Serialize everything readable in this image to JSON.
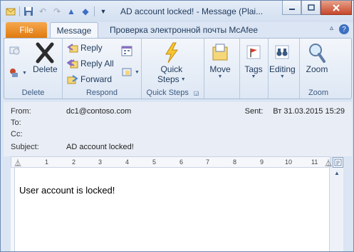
{
  "window": {
    "title": "AD account locked!  -  Message (Plai..."
  },
  "quick_access": [
    "mail-icon",
    "save-icon",
    "undo-icon",
    "redo-icon",
    "up-icon",
    "down-icon",
    "customize-icon"
  ],
  "tabs": {
    "file": "File",
    "message": "Message",
    "mcafee": "Проверка электронной почты McAfee"
  },
  "ribbon": {
    "delete_group": {
      "label": "Delete",
      "delete": "Delete"
    },
    "respond_group": {
      "label": "Respond",
      "reply": "Reply",
      "reply_all": "Reply All",
      "forward": "Forward"
    },
    "quick_steps_group": {
      "label": "Quick Steps",
      "button_line1": "Quick",
      "button_line2": "Steps"
    },
    "move": "Move",
    "tags": "Tags",
    "editing": "Editing",
    "zoom_group": {
      "label": "Zoom",
      "zoom": "Zoom"
    }
  },
  "header": {
    "from_label": "From:",
    "from_value": "dc1@contoso.com",
    "to_label": "To:",
    "cc_label": "Cc:",
    "subject_label": "Subject:",
    "subject_value": "AD account locked!",
    "sent_label": "Sent:",
    "sent_value": "Вт 31.03.2015 15:29"
  },
  "ruler_numbers": [
    "1",
    "2",
    "3",
    "4",
    "5",
    "6",
    "7",
    "8",
    "9",
    "10",
    "11"
  ],
  "body": {
    "text": "User account is locked!"
  },
  "colors": {
    "file_tab": "#e07a10",
    "frame": "#dbe5f3",
    "text": "#1e395b"
  }
}
